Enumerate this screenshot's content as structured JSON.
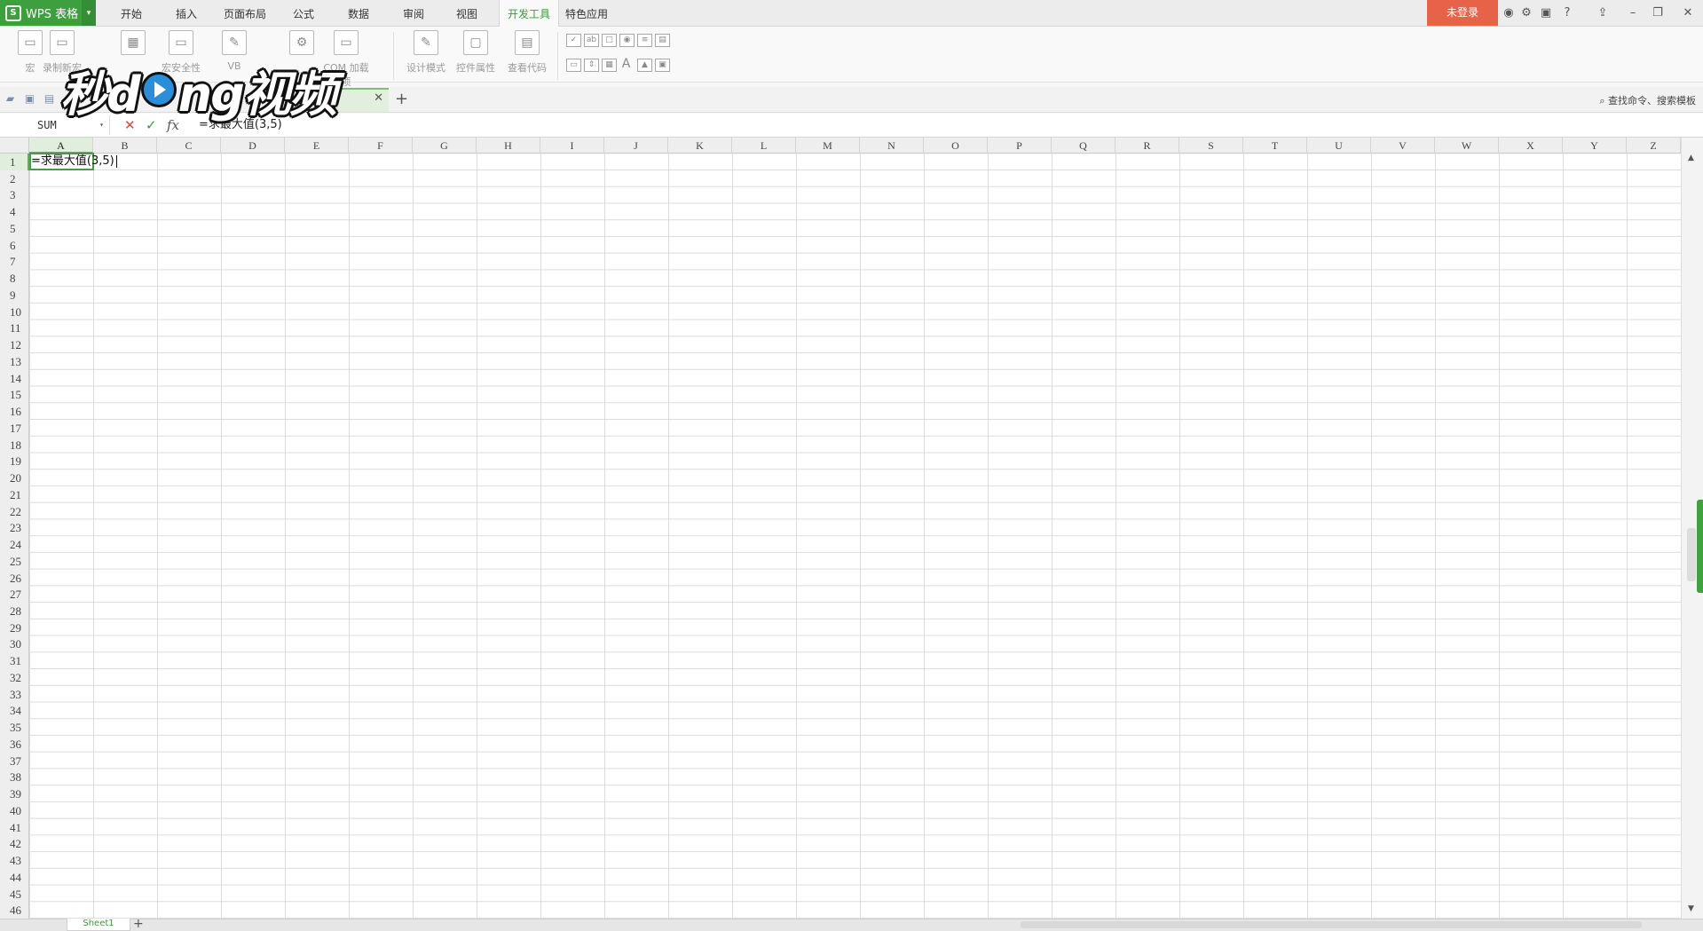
{
  "app": {
    "name": "WPS 表格",
    "logo_letter": "S"
  },
  "menu": {
    "tabs": [
      {
        "label": "开始"
      },
      {
        "label": "插入"
      },
      {
        "label": "页面布局"
      },
      {
        "label": "公式"
      },
      {
        "label": "数据"
      },
      {
        "label": "审阅"
      },
      {
        "label": "视图"
      },
      {
        "label": "开发工具",
        "active": true
      },
      {
        "label": "特色应用"
      }
    ],
    "login_label": "未登录"
  },
  "ribbon": {
    "buttons": [
      {
        "label": "宏",
        "icon": "macro-icon"
      },
      {
        "label": "录制新宏",
        "icon": "record-macro-icon"
      },
      {
        "label": "",
        "icon": "grid-icon"
      },
      {
        "label": "宏安全性",
        "icon": "macro-security-icon"
      },
      {
        "label": "VB",
        "icon": "vb-editor-icon"
      },
      {
        "label": "",
        "icon": "gear-icon"
      },
      {
        "label": "COM 加载项",
        "icon": "com-addin-icon"
      },
      {
        "label": "设计模式",
        "icon": "design-mode-icon"
      },
      {
        "label": "控件属性",
        "icon": "control-properties-icon"
      },
      {
        "label": "查看代码",
        "icon": "view-code-icon"
      }
    ]
  },
  "watermark": {
    "part1": "秒d",
    "part2": "ng视频"
  },
  "quickbar": {
    "search_label": "查找命令、搜索模板"
  },
  "formula": {
    "name_box": "SUM",
    "cancel_symbol": "✕",
    "confirm_symbol": "✓",
    "fx_symbol": "fx",
    "content": "=求最大值(3,5)"
  },
  "grid": {
    "columns": [
      "A",
      "B",
      "C",
      "D",
      "E",
      "F",
      "G",
      "H",
      "I",
      "J",
      "K",
      "L",
      "M",
      "N",
      "O",
      "P",
      "Q",
      "R",
      "S",
      "T",
      "U",
      "V",
      "W",
      "X",
      "Y",
      "Z"
    ],
    "active_column": "A",
    "row_count": 46,
    "active_row": 1,
    "active_cell_text": "=求最大值(3,5)"
  },
  "sheet": {
    "tab_label": "Sheet1",
    "add_label": "+"
  }
}
